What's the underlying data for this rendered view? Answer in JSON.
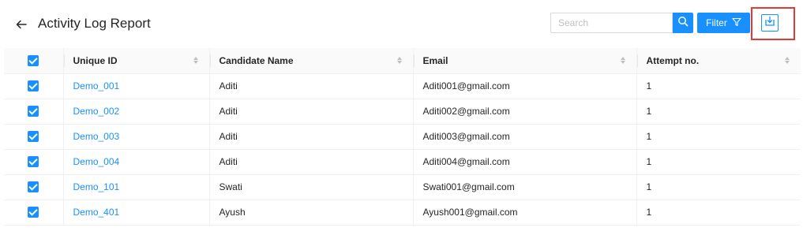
{
  "header": {
    "title": "Activity Log Report",
    "search_placeholder": "Search",
    "search_value": "",
    "filter_label": "Filter"
  },
  "colors": {
    "primary": "#1890ff",
    "highlight": "#e53935",
    "header_bg": "#fafafa",
    "border": "#f0f0f0"
  },
  "icons": {
    "back": "arrow-left-icon",
    "search": "search-icon",
    "filter": "filter-funnel-icon",
    "download": "download-icon",
    "sort": "sort-caret-icon",
    "check": "checkbox-checked-icon"
  },
  "table": {
    "columns": [
      "Unique ID",
      "Candidate Name",
      "Email",
      "Attempt no."
    ],
    "header_checked": true,
    "rows": [
      {
        "checked": true,
        "id": "Demo_001",
        "name": "Aditi",
        "email": "Aditi001@gmail.com",
        "attempt": "1"
      },
      {
        "checked": true,
        "id": "Demo_002",
        "name": "Aditi",
        "email": "Aditi002@gmail.com",
        "attempt": "1"
      },
      {
        "checked": true,
        "id": "Demo_003",
        "name": "Aditi",
        "email": "Aditi003@gmail.com",
        "attempt": "1"
      },
      {
        "checked": true,
        "id": "Demo_004",
        "name": "Aditi",
        "email": "Aditi004@gmail.com",
        "attempt": "1"
      },
      {
        "checked": true,
        "id": "Demo_101",
        "name": "Swati",
        "email": "Swati001@gmail.com",
        "attempt": "1"
      },
      {
        "checked": true,
        "id": "Demo_401",
        "name": "Ayush",
        "email": "Ayush001@gmail.com",
        "attempt": "1"
      }
    ]
  }
}
